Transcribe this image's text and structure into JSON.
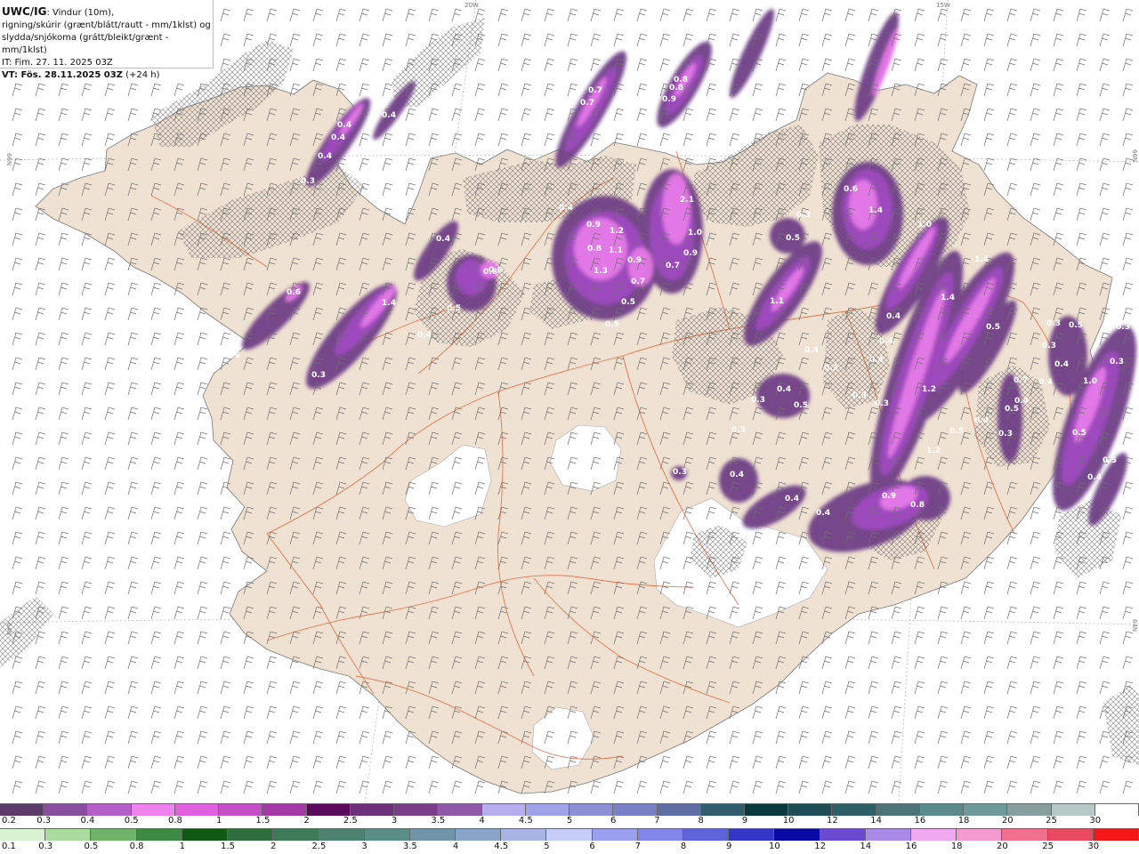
{
  "header": {
    "line1_bold": "UWC/IG",
    "line1_rest": ": Vindur (10m),",
    "line2": "rigning/skúrir (grænt/blátt/rautt - mm/1klst) og",
    "line3": "slydda/snjókoma (grátt/bleikt/grænt - mm/1klst)",
    "line4": "IT: Fim. 27. 11. 2025 03Z",
    "line5_bold": "VT: Fös. 28.11.2025 03Z",
    "line5_rest": " (+24 h)"
  },
  "grid_labels": {
    "w20": "20W",
    "w15": "15W",
    "n66_left": "66N",
    "n66_right": "66N",
    "n64_left": "64N",
    "n64_right": "64N"
  },
  "colors": {
    "land": "#f0e2d2",
    "ice": "#ffffff",
    "roads": "#e0633a",
    "barb": "#6f6f6f",
    "precip_light": "#6f3f86",
    "precip_mid": "#a04bc0",
    "precip_heavy": "#e67ae8"
  },
  "precip_labels": [
    {
      "v": "0.4"
    },
    {
      "v": "0.6"
    },
    {
      "v": "0.4"
    },
    {
      "v": "0.4"
    },
    {
      "v": "0.4"
    },
    {
      "v": "0.3"
    },
    {
      "v": "0.7"
    },
    {
      "v": "0.7"
    },
    {
      "v": "0.8"
    },
    {
      "v": "0.8"
    },
    {
      "v": "0.9"
    },
    {
      "v": "0.9"
    },
    {
      "v": "2.1"
    },
    {
      "v": "0.4"
    },
    {
      "v": "0.9"
    },
    {
      "v": "1.2"
    },
    {
      "v": "0.8"
    },
    {
      "v": "1.1"
    },
    {
      "v": "1.3"
    },
    {
      "v": "0.9"
    },
    {
      "v": "1.0"
    },
    {
      "v": "0.9"
    },
    {
      "v": "0.7"
    },
    {
      "v": "0.7"
    },
    {
      "v": "0.5"
    },
    {
      "v": "0.5"
    },
    {
      "v": "0.4"
    },
    {
      "v": "0.6"
    },
    {
      "v": "0.5"
    },
    {
      "v": "0.4"
    },
    {
      "v": "0.6"
    },
    {
      "v": "1.4"
    },
    {
      "v": "0.6"
    },
    {
      "v": "0.3"
    },
    {
      "v": "0.3"
    },
    {
      "v": "0.5"
    },
    {
      "v": "1.1"
    },
    {
      "v": "0.6"
    },
    {
      "v": "1.4"
    },
    {
      "v": "1.0"
    },
    {
      "v": "1.4"
    },
    {
      "v": "1.4"
    },
    {
      "v": "0.4"
    },
    {
      "v": "0.4"
    },
    {
      "v": "0.4"
    },
    {
      "v": "0.4"
    },
    {
      "v": "0.5"
    },
    {
      "v": "0.3"
    },
    {
      "v": "0.3"
    },
    {
      "v": "0.3"
    },
    {
      "v": "0.4"
    },
    {
      "v": "0.3"
    },
    {
      "v": "0.5"
    },
    {
      "v": "0.3"
    },
    {
      "v": "0.4"
    },
    {
      "v": "0.4"
    },
    {
      "v": "0.4"
    },
    {
      "v": "0.5"
    },
    {
      "v": "0.3"
    },
    {
      "v": "1.2"
    },
    {
      "v": "0.5"
    },
    {
      "v": "0.5"
    },
    {
      "v": "1.0"
    },
    {
      "v": "0.4"
    },
    {
      "v": "0.3"
    },
    {
      "v": "0.3"
    },
    {
      "v": "0.3"
    },
    {
      "v": "0.5"
    },
    {
      "v": "0.5"
    },
    {
      "v": "0.3"
    },
    {
      "v": "1.2"
    },
    {
      "v": "0.9"
    },
    {
      "v": "0.8"
    },
    {
      "v": "0.3"
    },
    {
      "v": "0.4"
    },
    {
      "v": "0.4"
    },
    {
      "v": "0.4"
    },
    {
      "v": "0.4"
    },
    {
      "v": "0.7"
    }
  ],
  "legend_snow": {
    "labels": [
      "0.2",
      "0.3",
      "0.4",
      "0.5",
      "0.8",
      "1",
      "1.5",
      "2",
      "2.5",
      "3",
      "3.5",
      "4",
      "4.5",
      "5",
      "6",
      "7",
      "8",
      "9",
      "10",
      "12",
      "14",
      "16",
      "18",
      "20",
      "25",
      "30"
    ],
    "colors": [
      "#5a3b6b",
      "#8a4e9e",
      "#b45ec7",
      "#f082f0",
      "#e060e0",
      "#c64fc8",
      "#a33aa8",
      "#5b0a5b",
      "#6d2f79",
      "#7a3d8a",
      "#8f58a8",
      "#b5aef0",
      "#9fa3e8",
      "#8c8fd6",
      "#7a80c6",
      "#5f6ea3",
      "#2f5d6e",
      "#0a3a3f",
      "#1f4d55",
      "#2e5f66",
      "#4a7478",
      "#5b8a8c",
      "#6e9a9b",
      "#869f9d",
      "#b7c9c6",
      "#ffffff"
    ]
  },
  "legend_rain": {
    "labels": [
      "0.1",
      "0.3",
      "0.5",
      "0.8",
      "1",
      "1.5",
      "2",
      "2.5",
      "3",
      "3.5",
      "4",
      "4.5",
      "5",
      "6",
      "7",
      "8",
      "9",
      "10",
      "12",
      "14",
      "16",
      "18",
      "20",
      "25",
      "30"
    ],
    "colors": [
      "#d9f2d2",
      "#a9dc9e",
      "#6fb46a",
      "#3d8a45",
      "#0e5a12",
      "#2e6e3c",
      "#3f7a58",
      "#4d8170",
      "#5a8d86",
      "#7195a8",
      "#8aa4c8",
      "#a7b5e4",
      "#c6cdf6",
      "#9a9ff0",
      "#8087e8",
      "#5f63d9",
      "#3336c6",
      "#0a0aa5",
      "#6a4ad0",
      "#a98ae8",
      "#f0a8f0",
      "#f59ad0",
      "#f0708e",
      "#ea4a60",
      "#f21818"
    ]
  }
}
